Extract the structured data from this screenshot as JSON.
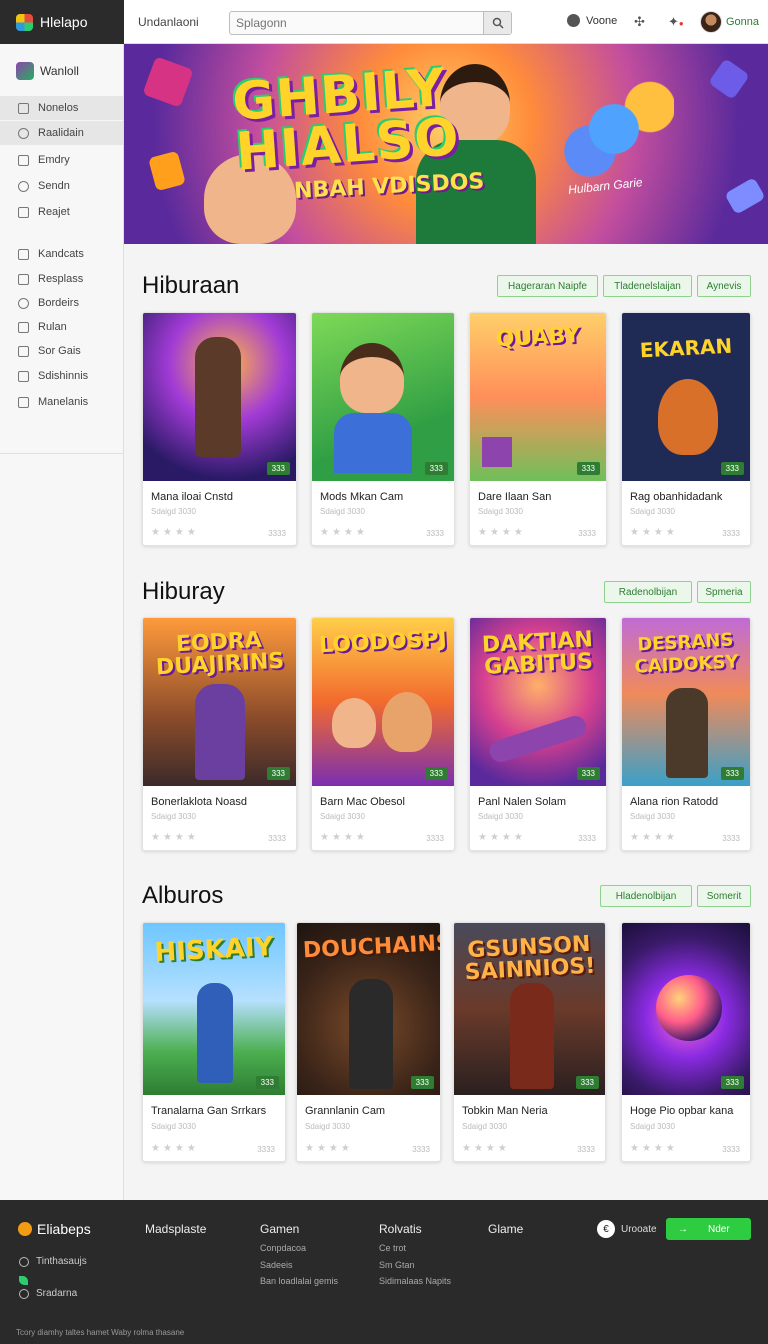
{
  "app": {
    "name": "Hlelapo"
  },
  "topbar": {
    "crumb": "Undanlaoni",
    "search_placeholder": "Splagonn",
    "voice_label": "Voone",
    "user_name": "Gonna"
  },
  "sidebar": {
    "header": "Wanloll",
    "items": [
      {
        "label": "Nonelos",
        "icon": "home-icon"
      },
      {
        "label": "Raalidain",
        "icon": "search-icon"
      },
      {
        "label": "Emdry",
        "icon": "file-icon"
      },
      {
        "label": "Sendn",
        "icon": "people-icon"
      },
      {
        "label": "Reajet",
        "icon": "grid-icon"
      },
      {
        "label": "Kandcats",
        "icon": "box-icon"
      },
      {
        "label": "Resplass",
        "icon": "box-icon"
      },
      {
        "label": "Bordeirs",
        "icon": "people-icon"
      },
      {
        "label": "Rulan",
        "icon": "grid-icon"
      },
      {
        "label": "Sor Gais",
        "icon": "box-icon"
      },
      {
        "label": "Sdishinnis",
        "icon": "grid-icon"
      },
      {
        "label": "Manelanis",
        "icon": "home-icon"
      }
    ]
  },
  "hero": {
    "title_line1": "GHBILY",
    "title_line2": "HIALSO",
    "subtitle": "NBAH VDISDOS",
    "tagline": "Hulbarn Garie"
  },
  "sections": [
    {
      "title": "Hiburaan",
      "chips": [
        "Hageraran Naipfe",
        "Tladenelslaijan",
        "Aynevis"
      ],
      "cards": [
        {
          "thumb_text": "",
          "name": "Mana iloai Cnstd",
          "sub": "Sdaigd 3030",
          "meta": "3333",
          "badge": "333"
        },
        {
          "thumb_text": "",
          "name": "Mods Mkan Cam",
          "sub": "Sdaigd 3030",
          "meta": "3333",
          "badge": "333"
        },
        {
          "thumb_text": "QUABY",
          "name": "Dare Ilaan San",
          "sub": "Sdaigd 3030",
          "meta": "3333",
          "badge": "333"
        },
        {
          "thumb_text": "EKARAN",
          "name": "Rag obanhidadank",
          "sub": "Sdaigd 3030",
          "meta": "3333",
          "badge": "333"
        }
      ]
    },
    {
      "title": "Hiburay",
      "chips": [
        "Radenolbijan",
        "Spmeria"
      ],
      "cards": [
        {
          "thumb_text": "EODRA DUAJIRINS",
          "name": "Bonerlaklota Noasd",
          "sub": "Sdaigd 3030",
          "meta": "3333",
          "badge": "333"
        },
        {
          "thumb_text": "LOODOSPJ",
          "name": "Barn Mac Obesol",
          "sub": "Sdaigd 3030",
          "meta": "3333",
          "badge": "333"
        },
        {
          "thumb_text": "DAKTIAN GABITUS",
          "name": "Panl Nalen Solam",
          "sub": "Sdaigd 3030",
          "meta": "3333",
          "badge": "333"
        },
        {
          "thumb_text": "DESRANS CAIDOKSY",
          "name": "Alana rion Ratodd",
          "sub": "Sdaigd 3030",
          "meta": "3333",
          "badge": "333"
        }
      ]
    },
    {
      "title": "Alburos",
      "chips": [
        "Hladenolbijan",
        "Somerit"
      ],
      "cards": [
        {
          "thumb_text": "HISKAIY",
          "name": "Tranalarna Gan Srrkars",
          "sub": "Sdaigd 3030",
          "meta": "3333",
          "badge": "333"
        },
        {
          "thumb_text": "DOUCHAINS",
          "name": "Grannlanin Cam",
          "sub": "Sdaigd 3030",
          "meta": "3333",
          "badge": "333"
        },
        {
          "thumb_text": "GSUNSON SAINNIOS!",
          "name": "Tobkin Man Neria",
          "sub": "Sdaigd 3030",
          "meta": "3333",
          "badge": "333"
        },
        {
          "thumb_text": "",
          "name": "Hoge Pio opbar kana",
          "sub": "Sdaigd 3030",
          "meta": "3333",
          "badge": "333"
        }
      ]
    }
  ],
  "footer": {
    "brand": "Eliabeps",
    "options": [
      "Tinthasaujs",
      "Sradarna"
    ],
    "columns": [
      {
        "heading": "Madsplaste",
        "links": []
      },
      {
        "heading": "Gamen",
        "links": [
          "Conpdacoa",
          "Sadeeis",
          "Ban loadlalai gemis"
        ]
      },
      {
        "heading": "Rolvatis",
        "links": [
          "Ce trot",
          "Sm Gtan",
          "Sidimalaas Napits"
        ]
      },
      {
        "heading": "Glame",
        "links": []
      }
    ],
    "voice_label": "Urooate",
    "cta_label": "Nder",
    "bottom_text": "Tcory diamhy taltes hamet Waby rolma thasane"
  },
  "colors": {
    "accent": "#2e7d32",
    "chip_bg": "#eaf7ea",
    "footer_bg": "#2a2a2a",
    "cta": "#2ecc40"
  }
}
